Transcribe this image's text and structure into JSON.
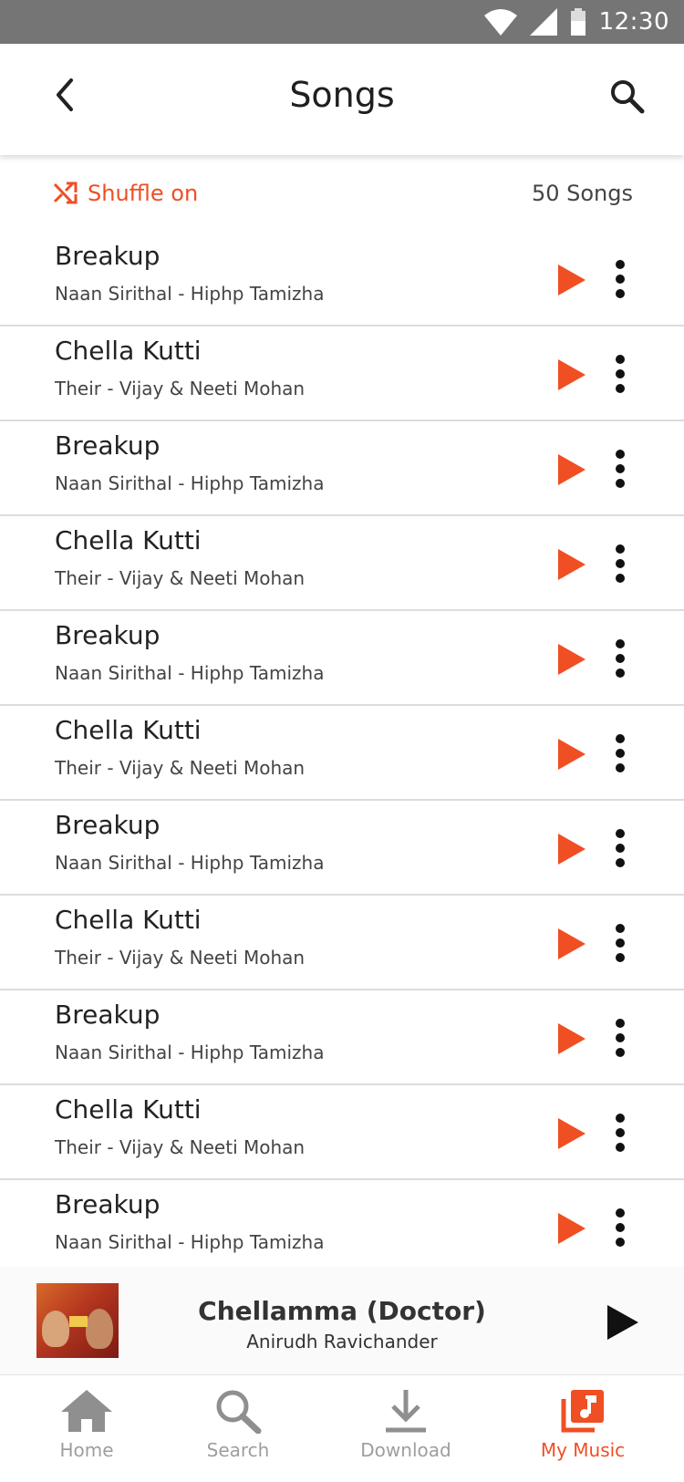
{
  "status_bar": {
    "time": "12:30"
  },
  "header": {
    "title": "Songs"
  },
  "shuffle": {
    "label": "Shuffle on",
    "count_label": "50 Songs"
  },
  "songs": [
    {
      "title": "Breakup",
      "subtitle": "Naan Sirithal - Hiphp Tamizha"
    },
    {
      "title": "Chella Kutti",
      "subtitle": "Their - Vijay & Neeti Mohan"
    },
    {
      "title": "Breakup",
      "subtitle": "Naan Sirithal - Hiphp Tamizha"
    },
    {
      "title": "Chella Kutti",
      "subtitle": "Their - Vijay & Neeti Mohan"
    },
    {
      "title": "Breakup",
      "subtitle": "Naan Sirithal - Hiphp Tamizha"
    },
    {
      "title": "Chella Kutti",
      "subtitle": "Their - Vijay & Neeti Mohan"
    },
    {
      "title": "Breakup",
      "subtitle": "Naan Sirithal - Hiphp Tamizha"
    },
    {
      "title": "Chella Kutti",
      "subtitle": "Their - Vijay & Neeti Mohan"
    },
    {
      "title": "Breakup",
      "subtitle": "Naan Sirithal - Hiphp Tamizha"
    },
    {
      "title": "Chella Kutti",
      "subtitle": "Their - Vijay & Neeti Mohan"
    },
    {
      "title": "Breakup",
      "subtitle": "Naan Sirithal - Hiphp Tamizha"
    }
  ],
  "now_playing": {
    "title": "Chellamma (Doctor)",
    "artist": "Anirudh Ravichander"
  },
  "nav": {
    "items": [
      {
        "label": "Home",
        "icon": "home-icon"
      },
      {
        "label": "Search",
        "icon": "search-icon"
      },
      {
        "label": "Download",
        "icon": "download-icon"
      },
      {
        "label": "My Music",
        "icon": "music-library-icon",
        "active": true
      }
    ]
  },
  "colors": {
    "accent": "#f04e23",
    "statusbar": "#757575",
    "nav_inactive": "#9e9e9e"
  }
}
